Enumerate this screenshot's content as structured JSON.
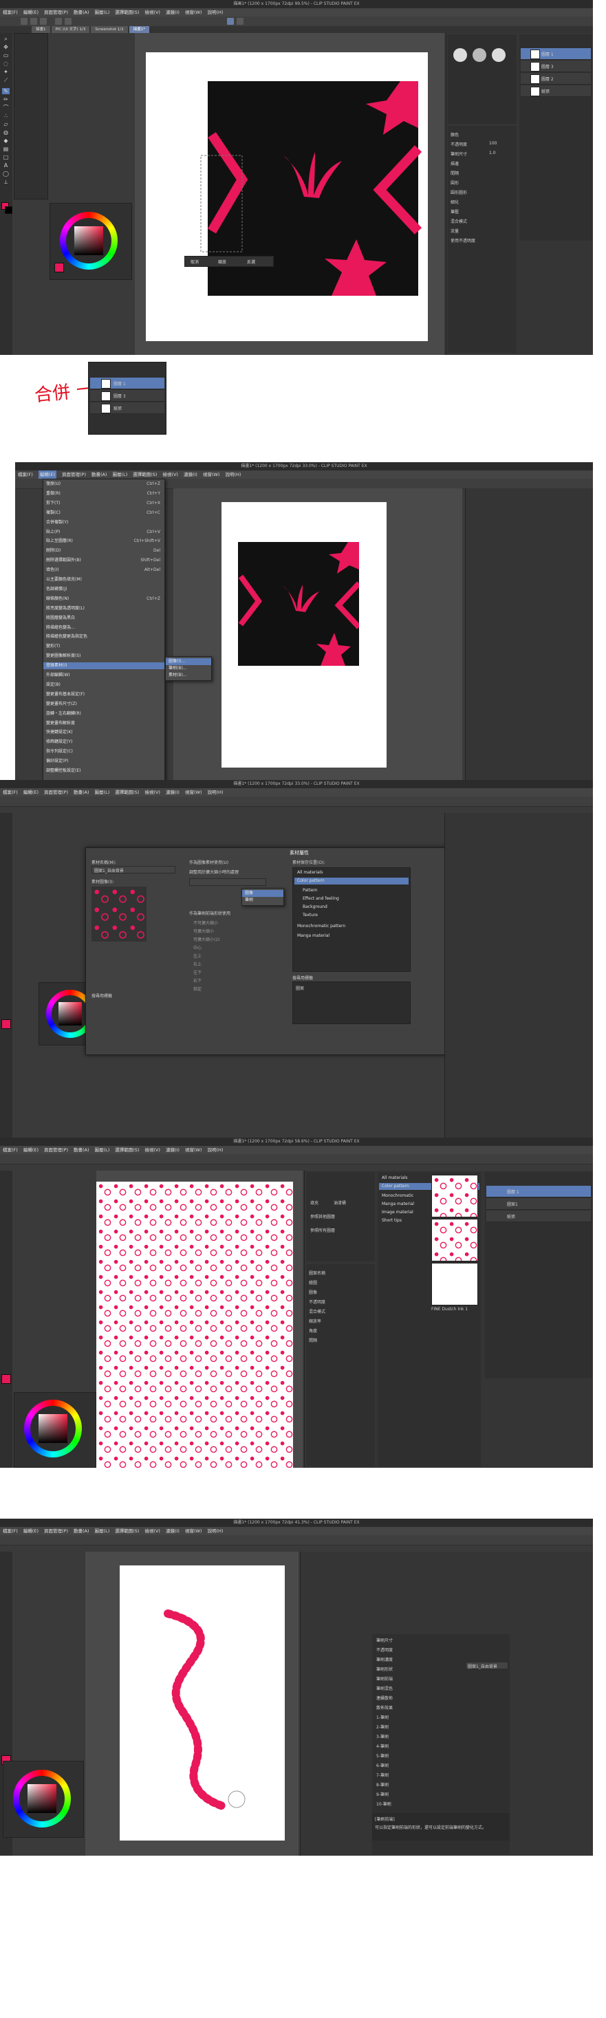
{
  "shot1": {
    "title": "描画1* (1200 x 1700px 72dpi 99.5%) - CLIP STUDIO PAINT EX",
    "menu": [
      "檔案(F)",
      "編輯(E)",
      "頁面管理(P)",
      "動畫(A)",
      "圖層(L)",
      "選擇範圍(S)",
      "檢視(V)",
      "濾鏡(I)",
      "視窗(W)",
      "說明(H)"
    ],
    "tabs": [
      "描畫1",
      "PIC (UI 文字) 1/3",
      "Screenshot 1/1",
      "描畫1*"
    ],
    "selection_buttons": [
      "取消",
      "縮放",
      "反選"
    ],
    "property_labels": [
      "顏色",
      "不透明度",
      "筆刷尺寸",
      "描邊",
      "間隔",
      "圓形",
      "圓形圖形",
      "細化",
      "筆壓",
      "混合模式",
      "流量",
      "使用不透明度"
    ],
    "brush_size_value": "1.0",
    "opacity_value": "100",
    "layer_names": [
      "圖層 1",
      "圖層 3",
      "圖層 2",
      "紙張"
    ]
  },
  "shot1_callout": {
    "handwritten_label": "合併",
    "layer_labels": [
      "圖層 1",
      "圖層 3",
      "紙張"
    ]
  },
  "shot2": {
    "title": "描畫1* (1200 x 1700px 72dpi 33.0%) - CLIP STUDIO PAINT EX",
    "menu_items": [
      {
        "label": "復原(U)",
        "shortcut": "Ctrl+Z"
      },
      {
        "label": "重做(R)",
        "shortcut": "Ctrl+Y"
      },
      {
        "label": "剪下(T)",
        "shortcut": "Ctrl+X"
      },
      {
        "label": "複製(C)",
        "shortcut": "Ctrl+C"
      },
      {
        "label": "合併複製(Y)",
        "shortcut": ""
      },
      {
        "label": "貼上(P)",
        "shortcut": "Ctrl+V"
      },
      {
        "label": "貼上至圖層(R)",
        "shortcut": "Ctrl+Shift+V"
      },
      {
        "label": "刪除(D)",
        "shortcut": "Del"
      },
      {
        "label": "刪除選擇範圍外(B)",
        "shortcut": "Shift+Del"
      },
      {
        "label": "填色(I)",
        "shortcut": "Alt+Del"
      },
      {
        "label": "以主要顏色填充(M)",
        "shortcut": ""
      },
      {
        "label": "色調補償(J)",
        "shortcut": ""
      },
      {
        "label": "線條顏色(N)",
        "shortcut": "Ctrl+Z"
      },
      {
        "label": "將亮度變為透明度(L)",
        "shortcut": ""
      },
      {
        "label": "將圖層變為黑白",
        "shortcut": ""
      },
      {
        "label": "將描繪色變為…",
        "shortcut": ""
      },
      {
        "label": "將描繪色變更為指定色",
        "shortcut": ""
      },
      {
        "label": "變形(T)",
        "shortcut": ""
      },
      {
        "label": "變更圖像解析度(S)",
        "shortcut": ""
      },
      {
        "label": "登錄素材(I)",
        "shortcut": ""
      },
      {
        "label": "外部編輯(W)",
        "shortcut": ""
      },
      {
        "label": "設定(B)",
        "shortcut": ""
      },
      {
        "label": "變更畫布基本設定(F)",
        "shortcut": ""
      },
      {
        "label": "變更畫布尺寸(Z)",
        "shortcut": ""
      },
      {
        "label": "旋轉・左右翻轉(R)",
        "shortcut": ""
      },
      {
        "label": "變更畫布解析度",
        "shortcut": ""
      },
      {
        "label": "快捷鍵設定(K)",
        "shortcut": ""
      },
      {
        "label": "修飾鍵設定(Y)",
        "shortcut": ""
      },
      {
        "label": "指令列設定(C)",
        "shortcut": ""
      },
      {
        "label": "偏好設定(P)",
        "shortcut": ""
      },
      {
        "label": "調整觸控板設定(E)",
        "shortcut": ""
      }
    ],
    "submenu_items": [
      "圖像(I)...",
      "筆刷(B)...",
      "素材(B)..."
    ],
    "highlighted_item": "登錄素材(I)"
  },
  "shot3": {
    "title": "描畫1* (1200 x 1700px 72dpi 33.0%) - CLIP STUDIO PAINT EX",
    "dialog_title": "素材屬性",
    "name_label": "素材名稱(M):",
    "name_value": "圖案1_自由背景",
    "image_label": "素材圖像(I):",
    "option_checks": [
      "作為圖像素材使用(U)",
      "調整用於擴大縮小時的處理",
      "不可擴大縮小",
      "可擴大縮小",
      "可擴大縮小(2)",
      "中心",
      "左上",
      "右上",
      "左下",
      "右下",
      "指定"
    ],
    "brush_check": "作為筆刷前端形狀使用",
    "tag_label": "搜尋用標籤",
    "save_label": "素材保存位置(O):",
    "tree": [
      "All materials",
      "Color pattern",
      "Pattern",
      "Effect and feeling",
      "Background",
      "Texture",
      "Monochromatic pattern",
      "Manga material"
    ],
    "tree_highlight": "Color pattern",
    "dropdown_items": [
      "圖像",
      "筆刷"
    ],
    "ok": "OK",
    "cancel": "取消",
    "tag_value": "圖案"
  },
  "shot4": {
    "title": "描畫1* (1200 x 1700px 72dpi 58.6%) - CLIP STUDIO PAINT EX",
    "material_tree": [
      "All materials",
      "Color pattern",
      "Monochromatic",
      "Manga material",
      "Image material",
      "Short tips"
    ],
    "tile_caption": "FINE Dustch Ink 1",
    "sub_tools": [
      "填充",
      "油漆桶",
      "參照其他圖層",
      "參照所有圖層"
    ],
    "properties": [
      "圖案名稱",
      "繪圖",
      "圖像",
      "不透明度",
      "混合模式",
      "縮放率",
      "角度",
      "間隔"
    ],
    "layer_names": [
      "圖層 1",
      "圖案1",
      "紙張"
    ]
  },
  "shot5": {
    "title": "描畫1* (1200 x 1700px 72dpi 41.3%) - CLIP STUDIO PAINT EX",
    "brush_settings": [
      "筆刷尺寸",
      "不透明度",
      "筆刷濃度",
      "筆刷形狀",
      "筆刷前端",
      "筆刷混色",
      "連續散佈",
      "散佈效果",
      "1-筆刷",
      "2-筆刷",
      "3-筆刷",
      "4-筆刷",
      "5-筆刷",
      "6-筆刷",
      "7-筆刷",
      "8-筆刷",
      "9-筆刷",
      "10-筆刷"
    ],
    "brush_tip_value": "圖案1_自由背景",
    "note": "[筆刷前端]",
    "note_detail": "可以指定筆刷前端的形狀，還可以設定前端筆刷的變化方式。"
  }
}
